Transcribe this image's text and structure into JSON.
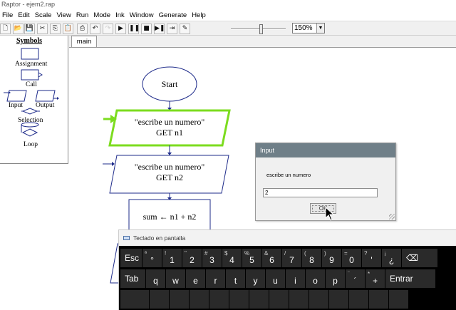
{
  "window": {
    "title": "Raptor - ejem2.rap"
  },
  "menu": [
    "File",
    "Edit",
    "Scale",
    "View",
    "Run",
    "Mode",
    "Ink",
    "Window",
    "Generate",
    "Help"
  ],
  "toolbar": {
    "buttons": [
      {
        "icon": "new-file-icon",
        "glyph": "🗋"
      },
      {
        "icon": "open-folder-icon",
        "glyph": "📂"
      },
      {
        "icon": "save-icon",
        "glyph": "💾"
      },
      {
        "icon": "cut-icon",
        "glyph": "✂"
      },
      {
        "icon": "copy-icon",
        "glyph": "⎘"
      },
      {
        "icon": "paste-icon",
        "glyph": "📋"
      },
      {
        "icon": "print-icon",
        "glyph": "⎙"
      },
      {
        "icon": "undo-icon",
        "glyph": "↶"
      },
      {
        "icon": "redo-icon",
        "glyph": "↷",
        "disabled": true
      },
      {
        "icon": "play-icon",
        "glyph": "▶"
      },
      {
        "icon": "pause-icon",
        "glyph": "❚❚"
      },
      {
        "icon": "stop-icon",
        "glyph": "■"
      },
      {
        "icon": "step-icon",
        "glyph": "▶❚"
      },
      {
        "icon": "step-into-icon",
        "glyph": "⇥"
      },
      {
        "icon": "pen-icon",
        "glyph": "✎"
      }
    ],
    "speed_slider_level": 0.55,
    "zoom": "150%"
  },
  "symbols": {
    "title": "Symbols",
    "assignment": "Assignment",
    "call": "Call",
    "input": "Input",
    "output": "Output",
    "selection": "Selection",
    "loop": "Loop"
  },
  "tabs": [
    "main"
  ],
  "flowchart": {
    "start": "Start",
    "input1_prompt": "\"escribe un numero\"",
    "input1_get": "GET n1",
    "input2_prompt": "\"escribe un numero\"",
    "input2_get": "GET n2",
    "assign": "sum ← n1 + n2"
  },
  "dialog": {
    "title": "Input",
    "prompt": "escribe un numero",
    "value": "2",
    "ok": "OK"
  },
  "keyboard": {
    "title": "Teclado en pantalla",
    "rows": [
      [
        {
          "main": "Esc",
          "wide": true
        },
        {
          "main": "°",
          "sec": "ª"
        },
        {
          "main": "1",
          "sec": "!"
        },
        {
          "main": "2",
          "sec": "\""
        },
        {
          "main": "3",
          "sec": "#"
        },
        {
          "main": "4",
          "sec": "$"
        },
        {
          "main": "5",
          "sec": "%"
        },
        {
          "main": "6",
          "sec": "&"
        },
        {
          "main": "7",
          "sec": "/"
        },
        {
          "main": "8",
          "sec": "("
        },
        {
          "main": "9",
          "sec": ")"
        },
        {
          "main": "0",
          "sec": "="
        },
        {
          "main": "'",
          "sec": "?"
        },
        {
          "main": "¿",
          "sec": "¡"
        },
        {
          "main": "⌫",
          "wide": true
        }
      ],
      [
        {
          "main": "Tab",
          "wide": true
        },
        {
          "main": "q"
        },
        {
          "main": "w"
        },
        {
          "main": "e"
        },
        {
          "main": "r"
        },
        {
          "main": "t"
        },
        {
          "main": "y"
        },
        {
          "main": "u"
        },
        {
          "main": "i"
        },
        {
          "main": "o"
        },
        {
          "main": "p"
        },
        {
          "main": "´",
          "sec": "¨"
        },
        {
          "main": "+",
          "sec": "*"
        },
        {
          "main": "Entrar",
          "wide": true
        }
      ],
      [
        {
          "main": "",
          "wide": true
        },
        {
          "main": ""
        },
        {
          "main": ""
        },
        {
          "main": ""
        },
        {
          "main": ""
        },
        {
          "main": ""
        },
        {
          "main": ""
        },
        {
          "main": ""
        },
        {
          "main": ""
        },
        {
          "main": ""
        },
        {
          "main": ""
        },
        {
          "main": ""
        },
        {
          "main": ""
        },
        {
          "main": ""
        }
      ]
    ]
  },
  "colors": {
    "highlight": "#7cdc1f",
    "flow_border": "#1e2b8a",
    "dialog_title": "#6f7f88",
    "keyboard_bg": "#000000"
  }
}
